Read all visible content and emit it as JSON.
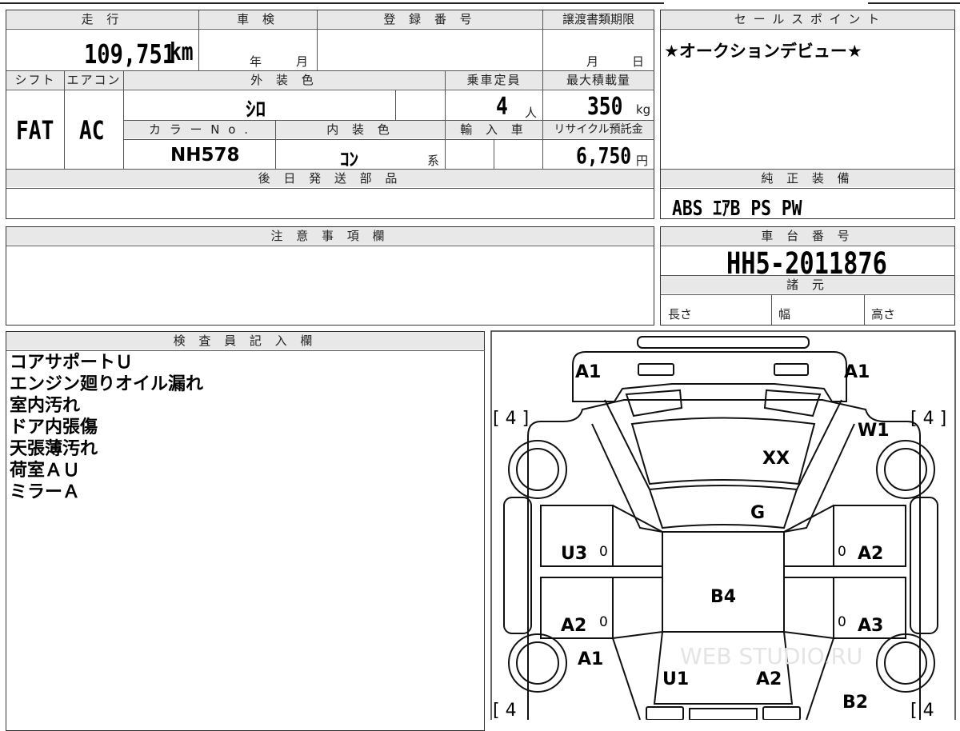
{
  "top_sheet": {
    "labels": {
      "mileage": "走 行",
      "inspection": "車 検",
      "registration": "登 録 番 号",
      "transfer_deadline": "譲渡書類期限",
      "shift": "シフト",
      "aircon": "エアコン",
      "exterior_color": "外 装 色",
      "capacity": "乗車定員",
      "max_load": "最大積載量",
      "color_no": "カ ラ ー N o .",
      "interior_color": "内 装 色",
      "imported": "輸 入 車",
      "recycle_fee": "リサイクル預託金",
      "later_parts": "後 日 発 送 部 品"
    },
    "mileage_value": "109,751",
    "mileage_unit": "km",
    "year_unit": "年",
    "month_unit": "月",
    "deadline_month": "月",
    "deadline_day": "日",
    "shift_value": "FAT",
    "aircon_value": "AC",
    "exterior_value": "ｼﾛ",
    "capacity_value": "4",
    "capacity_unit": "人",
    "max_load_value": "350",
    "max_load_unit": "kg",
    "color_no_value": "NH578",
    "interior_value": "ｺﾝ",
    "interior_suffix": "系",
    "recycle_value": "6,750",
    "recycle_unit": "円"
  },
  "sales_point": {
    "header": "セ ー ル ス ポ イ ン ト",
    "text": "★オークションデビュー★"
  },
  "equipment": {
    "header": "純 正 装 備",
    "value": "ABS ｴｱB PS PW"
  },
  "caution": {
    "header": "注 意 事 項 欄"
  },
  "chassis": {
    "header": "車 台 番 号",
    "value": "HH5-2011876",
    "spec_header": "諸 元",
    "length": "長さ",
    "width": "幅",
    "height": "高さ"
  },
  "inspector": {
    "header": "検 査 員 記 入 欄",
    "notes": [
      "コアサポートＵ",
      "エンジン廻りオイル漏れ",
      "室内汚れ",
      "ドア内張傷",
      "天張薄汚れ",
      "荷室ＡＵ",
      "ミラーＡ"
    ]
  },
  "diagram": {
    "tire_top_left": "[ 4 ]",
    "tire_top_right": "[ 4 ]",
    "tire_bottom_left": "[ 4",
    "tire_bottom_right": "[ 4",
    "front_left": "A1",
    "front_right": "A1",
    "fender_right": "W1",
    "windshield": "XX",
    "cowl": "G",
    "door_left_front": "U3",
    "door_right_front": "A2",
    "roof": "B4",
    "door_left_rear": "A2",
    "door_right_rear": "A3",
    "quarter_left": "A1",
    "floor_left": "U1",
    "floor_right": "A2",
    "quarter_right": "B2",
    "pillar_mark": "0",
    "watermark": "WEB STUDIO.RU"
  }
}
